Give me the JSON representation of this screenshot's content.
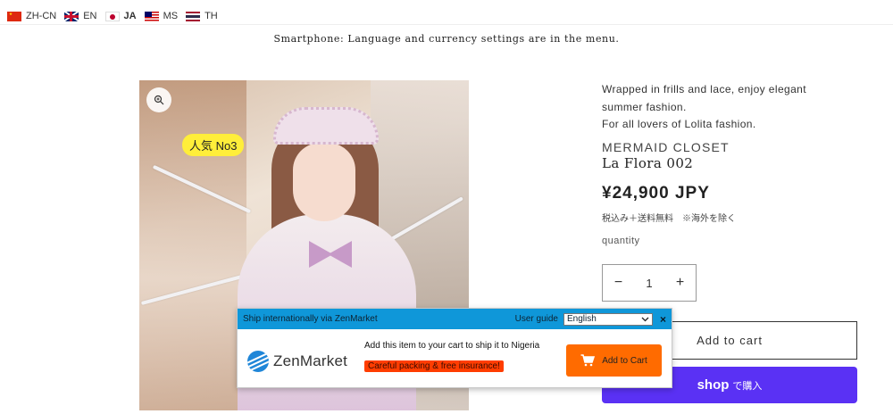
{
  "lang_bar": {
    "items": [
      {
        "code": "ZH-CN",
        "flag": "china-flag"
      },
      {
        "code": "EN",
        "flag": "uk-flag"
      },
      {
        "code": "JA",
        "flag": "japan-flag",
        "active": true
      },
      {
        "code": "MS",
        "flag": "malaysia-flag"
      },
      {
        "code": "TH",
        "flag": "thailand-flag"
      }
    ]
  },
  "notice": "Smartphone: Language and currency settings are in the menu.",
  "product": {
    "badge": "人気 No3",
    "description": [
      "Wrapped in frills and lace, enjoy elegant",
      "summer fashion.",
      "For all lovers of Lolita fashion."
    ],
    "brand": "MERMAID CLOSET",
    "title": "La Flora 002",
    "price": "¥24,900 JPY",
    "tax_note": "税込み＋送料無料　※海外を除く",
    "quantity_label": "quantity",
    "quantity": "1",
    "minus": "−",
    "plus": "+",
    "add_to_cart": "Add to cart",
    "shop_pay_logo": "shop",
    "shop_pay_text": "で購入"
  },
  "zenmarket": {
    "header_title": "Ship internationally via ZenMarket",
    "user_guide": "User guide",
    "language": "English",
    "close": "×",
    "logo_text": "ZenMarket",
    "message": "Add this item to your cart to ship it to Nigeria",
    "insurance": "Careful packing & free insurance!",
    "button": "Add to Cart",
    "colors": {
      "header": "#0f97d9",
      "button": "#ff6b00",
      "insurance": "#ff3d00"
    }
  },
  "colors": {
    "shop_pay": "#5a31f4",
    "badge": "#ffee3a"
  }
}
